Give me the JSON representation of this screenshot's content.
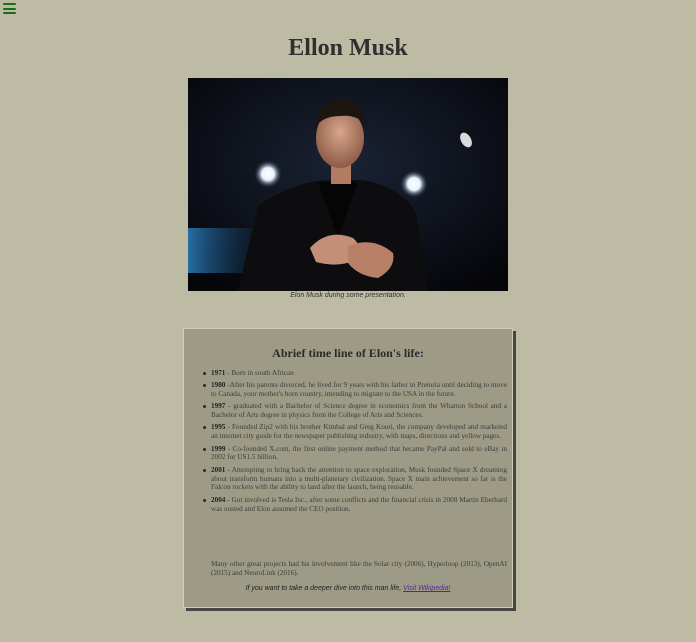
{
  "page": {
    "title": "Ellon Musk"
  },
  "photo": {
    "caption": "Elon Musk during some presentation."
  },
  "timeline": {
    "heading": "Abrief time line of Elon's life:",
    "events": [
      {
        "year": "1971",
        "text": " - Born in south African"
      },
      {
        "year": "1980",
        "text": " -After his parents divorced, he lived for 9 years with his father in Pretoria until deciding to move to Canada, your mother's born country, intending to migrate to the USA in the future."
      },
      {
        "year": "1997",
        "text": " - graduated with a Bachelor of Science degree in economics from the Wharton School and a Bachelor of Arts degree in physics from the College of Arts and Sciences."
      },
      {
        "year": "1995",
        "text": " - Founded Zip2 with his brother Kimbal and Greg Kouri, the company developed and marketed an internet city guide for the newspaper publishing industry, with maps, directions and yellow pages."
      },
      {
        "year": "1999",
        "text": " - Co-founded X.com, the first online payment method that became PayPal and sold to eBay in 2002 for US1.5 billion."
      },
      {
        "year": "2001",
        "text": " - Attempting to bring back the attention to space exploration, Musk founded Space X dreaming about transform humans into a multi-planetary civilization. Space X main achievement so far is the Falcon rockets with the ability to land after the launch, being reusable."
      },
      {
        "year": "2004",
        "text": " - Got involved is Tesla Inc., after some conflicts and the financial crisis in 2008 Martin Eberhard was ousted and Elon assumed the CEO position."
      }
    ],
    "note": "Many other great projects had his involvement like the Solar city (2006), Hyperloop (2013), OpenAI (2015) and NeuroLink (2016).",
    "cta_text": "If you want to take a deeper dive into this man life, ",
    "cta_link": "Visit Wikipedia!"
  },
  "colors": {
    "background": "#bdbba3",
    "box": "#9d9b86",
    "menu_icon": "#1b6b1b",
    "link": "#5a1fa8"
  },
  "icons": {
    "menu": "hamburger-menu-icon"
  }
}
